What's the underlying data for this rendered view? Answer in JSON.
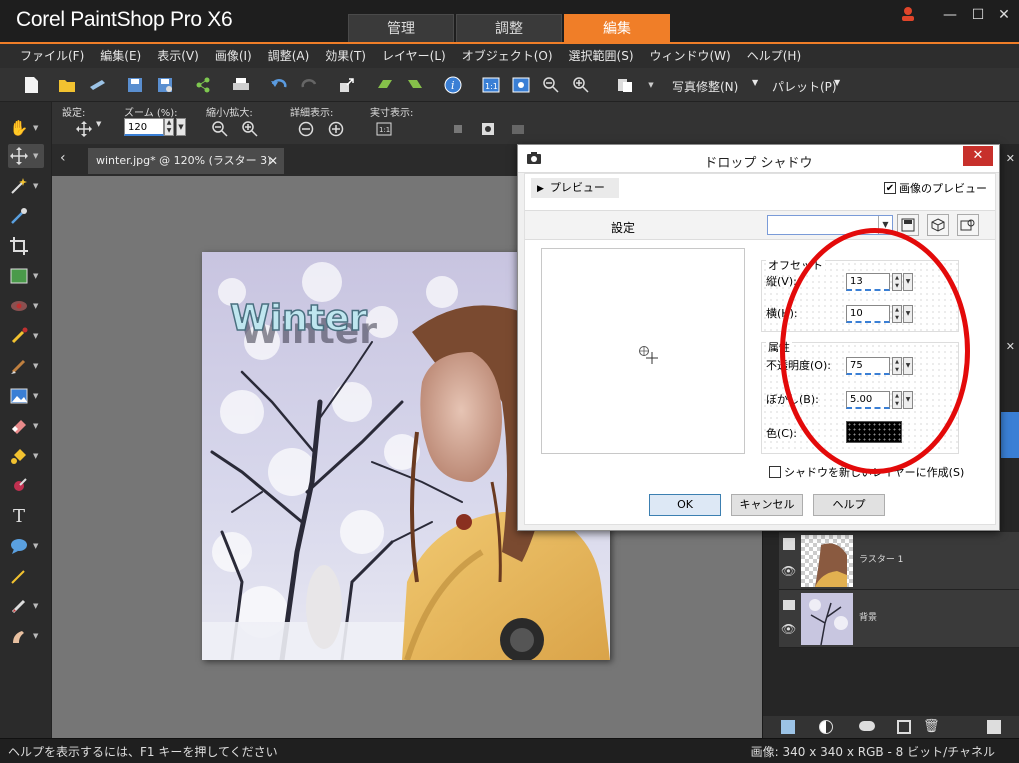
{
  "app": {
    "title": "Corel PaintShop Pro X6",
    "mode_tabs": [
      "管理",
      "調整",
      "編集"
    ],
    "active_mode": "編集",
    "accent_color": "#f07e28"
  },
  "menu": [
    "ファイル(F)",
    "編集(E)",
    "表示(V)",
    "画像(I)",
    "調整(A)",
    "効果(T)",
    "レイヤー(L)",
    "オブジェクト(O)",
    "選択範囲(S)",
    "ウィンドウ(W)",
    "ヘルプ(H)"
  ],
  "toolbar": {
    "photo_fix_label": "写真修整(N)",
    "palette_label": "パレット(P)"
  },
  "options": {
    "settings_label": "設定:",
    "zoom_label": "ズーム (%):",
    "zoom_value": "120",
    "zoom_inout_label": "縮小/拡大:",
    "detail_label": "詳細表示:",
    "actual_label": "実寸表示:"
  },
  "document": {
    "tab_title": "winter.jpg* @ 120% (ラスター 3)",
    "image_text": "Winter"
  },
  "layers": [
    {
      "name": "ラスター 1"
    },
    {
      "name": "背景"
    }
  ],
  "status": {
    "help": "ヘルプを表示するには、F1 キーを押してください",
    "info": "画像:  340 x 340 x RGB - 8 ビット/チャネル"
  },
  "dialog": {
    "title": "ドロップ シャドウ",
    "preview_expander": "プレビュー",
    "image_preview_label": "画像のプレビュー",
    "image_preview_checked": true,
    "settings_label": "設定",
    "preset_value": "",
    "offset_group": "オフセット",
    "vertical_label": "縦(V):",
    "vertical_value": "13",
    "horizontal_label": "横(H):",
    "horizontal_value": "10",
    "attributes_group": "属性",
    "opacity_label": "不透明度(O):",
    "opacity_value": "75",
    "blur_label": "ぼかし(B):",
    "blur_value": "5.00",
    "color_label": "色(C):",
    "shadow_color": "#000000",
    "new_layer_label": "シャドウを新しいレイヤーに作成(S)",
    "new_layer_checked": false,
    "ok_label": "OK",
    "cancel_label": "キャンセル",
    "help_label": "ヘルプ"
  },
  "annotation_color": "#e30a0a"
}
